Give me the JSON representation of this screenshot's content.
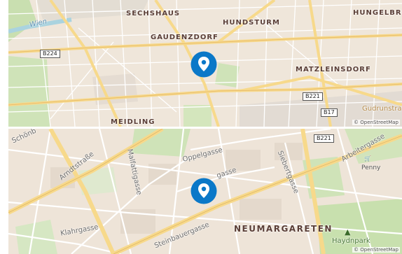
{
  "top_map": {
    "districts": [
      {
        "id": "sechshaus",
        "label": "SECHSHAUS"
      },
      {
        "id": "hundsturm",
        "label": "HUNDSTURM"
      },
      {
        "id": "hungelbrunn",
        "label": "HUNGELBRU"
      },
      {
        "id": "gaudenzdorf",
        "label": "GAUDENZDORF"
      },
      {
        "id": "matzleinsdorf",
        "label": "MATZLEINSDORF"
      },
      {
        "id": "meidling",
        "label": "MEIDLING"
      }
    ],
    "water": {
      "wien": "Wien"
    },
    "streets": {
      "gudrunstrasse": "Gudrunstraß"
    },
    "shields": {
      "b224": "B224",
      "b221": "B221",
      "b17": "B17"
    },
    "attribution": "© OpenStreetMap",
    "pin_icon": "location-pin-icon",
    "pin_color": "#0a78c8"
  },
  "bottom_map": {
    "districts": [
      {
        "id": "neumargareten",
        "label": "NEUMARGARETEN"
      }
    ],
    "streets": {
      "schoenbrunner": "Schönb",
      "arndtstrasse": "Arndtstraße",
      "malfattigasse": "Malfattigasse",
      "oppelgasse": "Oppelgasse",
      "siebertgasse": "Siebertgasse",
      "arbeitergasse": "Arbeitergasse",
      "gasse_partial": "gasse",
      "klahrgasse": "Klahrgasse",
      "steinbauergasse": "Steinbauergasse",
      "haydnpark": "Haydnpark"
    },
    "shields": {
      "b221": "B221"
    },
    "pois": {
      "penny": "Penny"
    },
    "attribution": "© OpenStreetMap",
    "pin_icon": "location-pin-icon",
    "pin_color": "#0a78c8"
  }
}
